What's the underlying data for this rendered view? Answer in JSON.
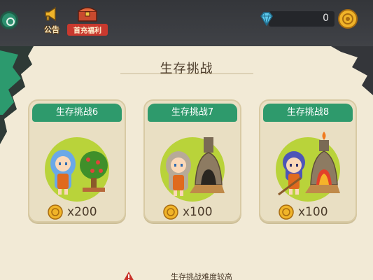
{
  "topbar": {
    "notice_label": "公告",
    "recharge_label": "首充福利",
    "gem_count": "0"
  },
  "panel": {
    "title": "生存挑战",
    "cards": [
      {
        "title": "生存挑战6",
        "cost": "x200"
      },
      {
        "title": "生存挑战7",
        "cost": "x100"
      },
      {
        "title": "生存挑战8",
        "cost": "x100"
      }
    ],
    "warning": "生存挑战难度较高"
  },
  "colors": {
    "accent_green": "#2e9a6c",
    "parchment": "#f2ead6",
    "text_brown": "#4b3b2a",
    "gold": "#f0b429"
  }
}
